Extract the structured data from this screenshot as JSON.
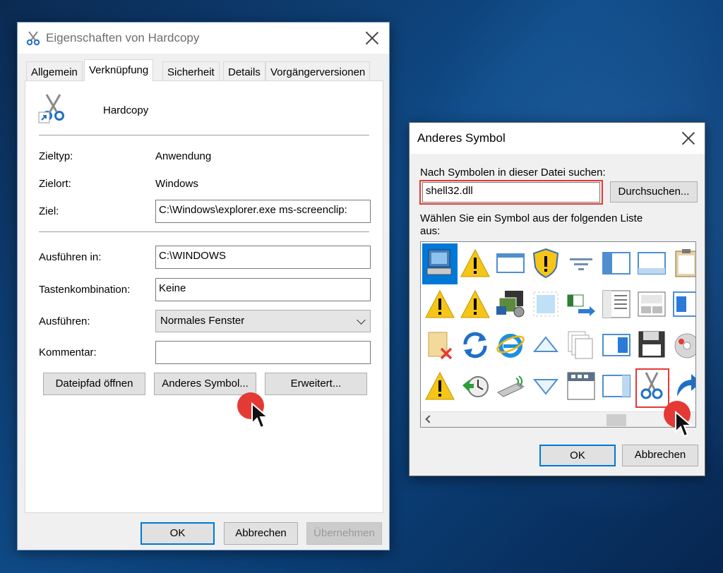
{
  "properties_dialog": {
    "title": "Eigenschaften von Hardcopy",
    "tabs": [
      "Allgemein",
      "Verknüpfung",
      "Sicherheit",
      "Details",
      "Vorgängerversionen"
    ],
    "active_tab": "Verknüpfung",
    "shortcut_name": "Hardcopy",
    "target_type_label": "Zieltyp:",
    "target_type_value": "Anwendung",
    "target_location_label": "Zielort:",
    "target_location_value": "Windows",
    "target_label": "Ziel:",
    "target_value": "C:\\Windows\\explorer.exe ms-screenclip:",
    "start_in_label": "Ausführen in:",
    "start_in_value": "C:\\WINDOWS",
    "shortcut_key_label": "Tastenkombination:",
    "shortcut_key_value": "Keine",
    "run_label": "Ausführen:",
    "run_value": "Normales Fenster",
    "comment_label": "Kommentar:",
    "comment_value": "",
    "open_location_button": "Dateipfad öffnen",
    "change_icon_button": "Anderes Symbol...",
    "advanced_button": "Erweitert...",
    "ok_button": "OK",
    "cancel_button": "Abbrechen",
    "apply_button": "Übernehmen"
  },
  "change_icon_dialog": {
    "title": "Anderes Symbol",
    "search_label": "Nach Symbolen in dieser Datei suchen:",
    "file_value": "shell32.dll",
    "browse_button": "Durchsuchen...",
    "list_label": "Wählen Sie ein Symbol aus der folgenden Liste aus:",
    "ok_button": "OK",
    "cancel_button": "Abbrechen",
    "icons": [
      "computer-icon",
      "warning-icon",
      "window-icon",
      "shield-warning-icon",
      "filter-icon",
      "window-sidebar-icon",
      "window-frame-icon",
      "clipboard-icon",
      "warning-icon",
      "warning-icon",
      "media-icon",
      "blank-frame-icon",
      "move-arrow-icon",
      "document-list-icon",
      "window-panels-icon",
      "window-blue-icon",
      "note-delete-icon",
      "sync-icon",
      "internet-explorer-icon",
      "triangle-up-icon",
      "pages-stack-icon",
      "window-split-icon",
      "floppy-disk-icon",
      "disc-icon",
      "warning-icon",
      "clock-restore-icon",
      "usb-drive-icon",
      "triangle-down-icon",
      "calendar-window-icon",
      "window-sidebar-icon",
      "scissors-icon",
      "shortcut-arrow-icon"
    ]
  }
}
